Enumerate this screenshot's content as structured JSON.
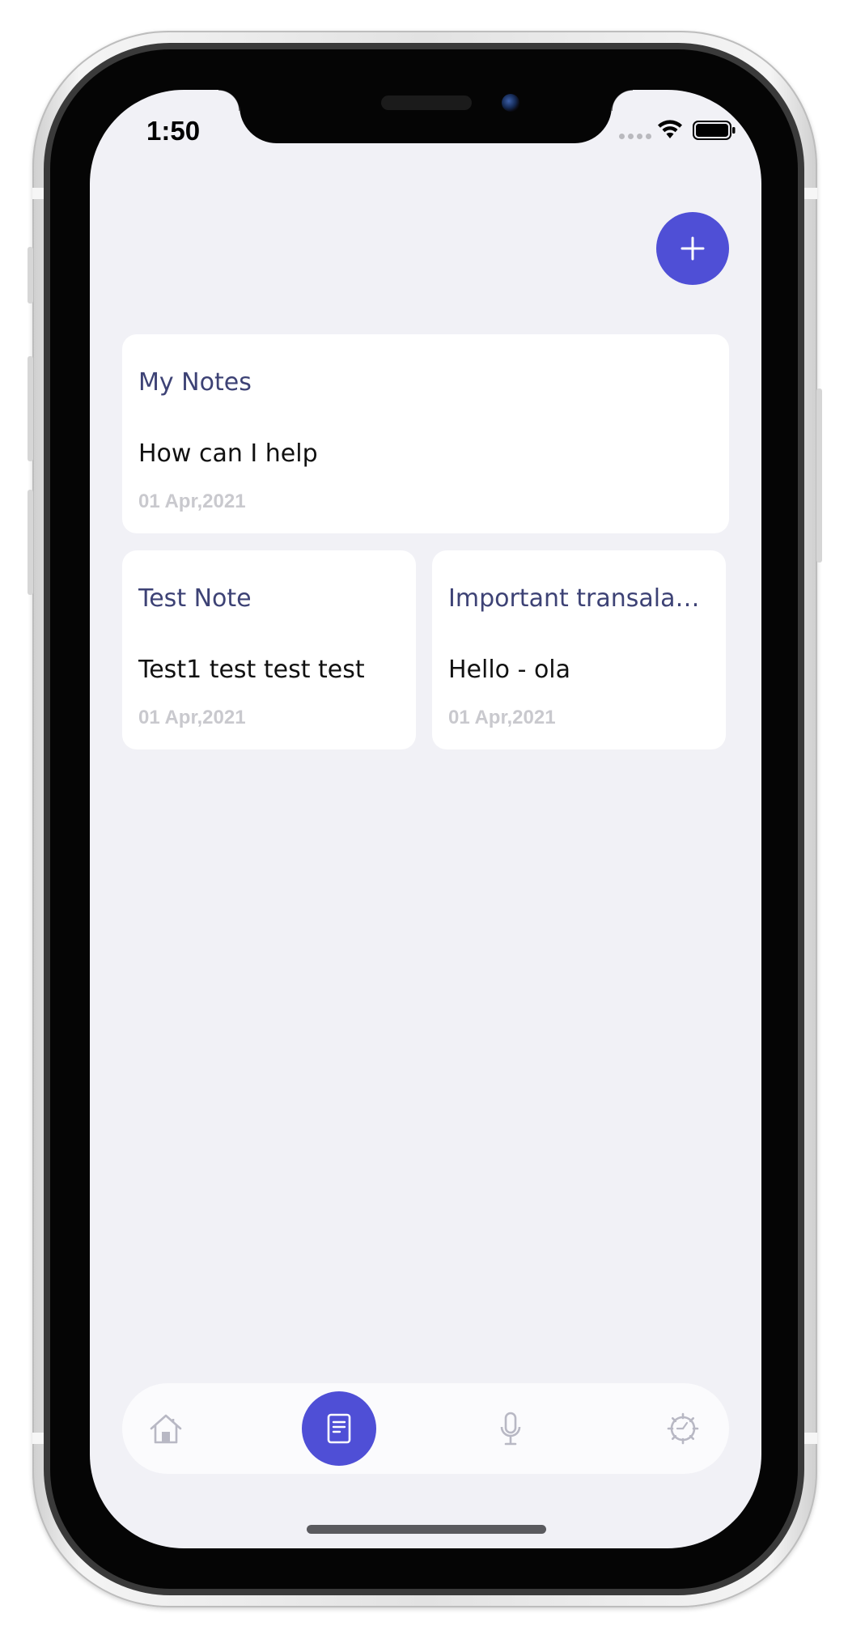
{
  "status_bar": {
    "time": "1:50"
  },
  "add_button": {
    "icon": "plus-icon"
  },
  "notes": [
    {
      "title": "My Notes",
      "body": "How can I help",
      "date": "01 Apr,2021"
    },
    {
      "title": "Test Note",
      "body": "Test1 test test test",
      "date": "01 Apr,2021"
    },
    {
      "title": "Important transala…",
      "body": "Hello - ola",
      "date": "01 Apr,2021"
    }
  ],
  "bottom_nav": {
    "items": [
      {
        "icon": "home-icon",
        "active": false
      },
      {
        "icon": "notes-icon",
        "active": true
      },
      {
        "icon": "microphone-icon",
        "active": false
      },
      {
        "icon": "settings-icon",
        "active": false
      }
    ]
  },
  "colors": {
    "accent": "#4f4fd6",
    "background": "#f1f1f6",
    "card": "#ffffff",
    "title_text": "#3d4275",
    "date_text": "#c9c9ce"
  }
}
